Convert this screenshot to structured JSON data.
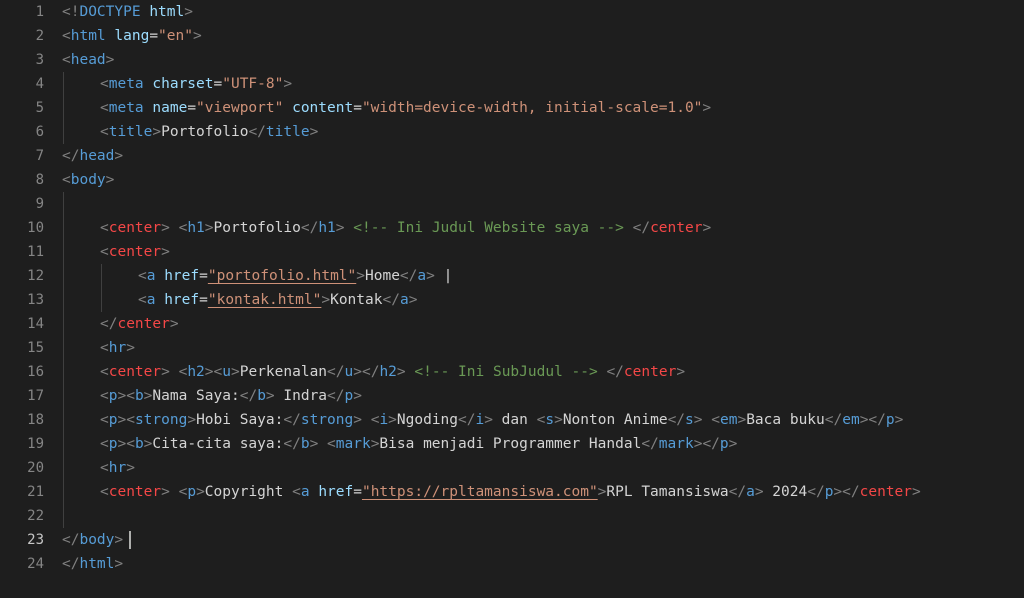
{
  "editor": {
    "language": "html",
    "current_line": 23,
    "lines": [
      {
        "n": "1",
        "indent": 0,
        "tokens": [
          [
            "p",
            "<!"
          ],
          [
            "t",
            "DOCTYPE"
          ],
          [
            "x",
            " "
          ],
          [
            "a",
            "html"
          ],
          [
            "p",
            ">"
          ]
        ]
      },
      {
        "n": "2",
        "indent": 0,
        "tokens": [
          [
            "p",
            "<"
          ],
          [
            "t",
            "html"
          ],
          [
            "x",
            " "
          ],
          [
            "a",
            "lang"
          ],
          [
            "x",
            "="
          ],
          [
            "s",
            "\"en\""
          ],
          [
            "p",
            ">"
          ]
        ]
      },
      {
        "n": "3",
        "indent": 0,
        "tokens": [
          [
            "p",
            "<"
          ],
          [
            "t",
            "head"
          ],
          [
            "p",
            ">"
          ]
        ]
      },
      {
        "n": "4",
        "indent": 1,
        "tokens": [
          [
            "p",
            "<"
          ],
          [
            "t",
            "meta"
          ],
          [
            "x",
            " "
          ],
          [
            "a",
            "charset"
          ],
          [
            "x",
            "="
          ],
          [
            "s",
            "\"UTF-8\""
          ],
          [
            "p",
            ">"
          ]
        ]
      },
      {
        "n": "5",
        "indent": 1,
        "tokens": [
          [
            "p",
            "<"
          ],
          [
            "t",
            "meta"
          ],
          [
            "x",
            " "
          ],
          [
            "a",
            "name"
          ],
          [
            "x",
            "="
          ],
          [
            "s",
            "\"viewport\""
          ],
          [
            "x",
            " "
          ],
          [
            "a",
            "content"
          ],
          [
            "x",
            "="
          ],
          [
            "s",
            "\"width=device-width, initial-scale=1.0\""
          ],
          [
            "p",
            ">"
          ]
        ]
      },
      {
        "n": "6",
        "indent": 1,
        "tokens": [
          [
            "p",
            "<"
          ],
          [
            "t",
            "title"
          ],
          [
            "p",
            ">"
          ],
          [
            "x",
            "Portofolio"
          ],
          [
            "p",
            "</"
          ],
          [
            "t",
            "title"
          ],
          [
            "p",
            ">"
          ]
        ]
      },
      {
        "n": "7",
        "indent": 0,
        "tokens": [
          [
            "p",
            "</"
          ],
          [
            "t",
            "head"
          ],
          [
            "p",
            ">"
          ]
        ]
      },
      {
        "n": "8",
        "indent": 0,
        "tokens": [
          [
            "p",
            "<"
          ],
          [
            "t",
            "body"
          ],
          [
            "p",
            ">"
          ]
        ]
      },
      {
        "n": "9",
        "indent": 0,
        "tokens": []
      },
      {
        "n": "10",
        "indent": 1,
        "tokens": [
          [
            "p",
            "<"
          ],
          [
            "r",
            "center"
          ],
          [
            "p",
            ">"
          ],
          [
            "x",
            " "
          ],
          [
            "p",
            "<"
          ],
          [
            "t",
            "h1"
          ],
          [
            "p",
            ">"
          ],
          [
            "x",
            "Portofolio"
          ],
          [
            "p",
            "</"
          ],
          [
            "t",
            "h1"
          ],
          [
            "p",
            ">"
          ],
          [
            "x",
            " "
          ],
          [
            "c",
            "<!-- Ini Judul Website saya -->"
          ],
          [
            "x",
            " "
          ],
          [
            "p",
            "</"
          ],
          [
            "r",
            "center"
          ],
          [
            "p",
            ">"
          ]
        ]
      },
      {
        "n": "11",
        "indent": 1,
        "tokens": [
          [
            "p",
            "<"
          ],
          [
            "r",
            "center"
          ],
          [
            "p",
            ">"
          ]
        ]
      },
      {
        "n": "12",
        "indent": 2,
        "tokens": [
          [
            "p",
            "<"
          ],
          [
            "t",
            "a"
          ],
          [
            "x",
            " "
          ],
          [
            "a",
            "href"
          ],
          [
            "x",
            "="
          ],
          [
            "su",
            "\"portofolio.html\""
          ],
          [
            "p",
            ">"
          ],
          [
            "x",
            "Home"
          ],
          [
            "p",
            "</"
          ],
          [
            "t",
            "a"
          ],
          [
            "p",
            ">"
          ],
          [
            "x",
            " | "
          ]
        ]
      },
      {
        "n": "13",
        "indent": 2,
        "tokens": [
          [
            "p",
            "<"
          ],
          [
            "t",
            "a"
          ],
          [
            "x",
            " "
          ],
          [
            "a",
            "href"
          ],
          [
            "x",
            "="
          ],
          [
            "su",
            "\"kontak.html\""
          ],
          [
            "p",
            ">"
          ],
          [
            "x",
            "Kontak"
          ],
          [
            "p",
            "</"
          ],
          [
            "t",
            "a"
          ],
          [
            "p",
            ">"
          ]
        ]
      },
      {
        "n": "14",
        "indent": 1,
        "tokens": [
          [
            "p",
            "</"
          ],
          [
            "r",
            "center"
          ],
          [
            "p",
            ">"
          ]
        ]
      },
      {
        "n": "15",
        "indent": 1,
        "tokens": [
          [
            "p",
            "<"
          ],
          [
            "t",
            "hr"
          ],
          [
            "p",
            ">"
          ]
        ]
      },
      {
        "n": "16",
        "indent": 1,
        "tokens": [
          [
            "p",
            "<"
          ],
          [
            "r",
            "center"
          ],
          [
            "p",
            ">"
          ],
          [
            "x",
            " "
          ],
          [
            "p",
            "<"
          ],
          [
            "t",
            "h2"
          ],
          [
            "p",
            "><"
          ],
          [
            "t",
            "u"
          ],
          [
            "p",
            ">"
          ],
          [
            "x",
            "Perkenalan"
          ],
          [
            "p",
            "</"
          ],
          [
            "t",
            "u"
          ],
          [
            "p",
            "></"
          ],
          [
            "t",
            "h2"
          ],
          [
            "p",
            ">"
          ],
          [
            "x",
            " "
          ],
          [
            "c",
            "<!-- Ini SubJudul -->"
          ],
          [
            "x",
            " "
          ],
          [
            "p",
            "</"
          ],
          [
            "r",
            "center"
          ],
          [
            "p",
            ">"
          ]
        ]
      },
      {
        "n": "17",
        "indent": 1,
        "tokens": [
          [
            "p",
            "<"
          ],
          [
            "t",
            "p"
          ],
          [
            "p",
            "><"
          ],
          [
            "t",
            "b"
          ],
          [
            "p",
            ">"
          ],
          [
            "x",
            "Nama Saya:"
          ],
          [
            "p",
            "</"
          ],
          [
            "t",
            "b"
          ],
          [
            "p",
            ">"
          ],
          [
            "x",
            " Indra"
          ],
          [
            "p",
            "</"
          ],
          [
            "t",
            "p"
          ],
          [
            "p",
            ">"
          ]
        ]
      },
      {
        "n": "18",
        "indent": 1,
        "tokens": [
          [
            "p",
            "<"
          ],
          [
            "t",
            "p"
          ],
          [
            "p",
            "><"
          ],
          [
            "t",
            "strong"
          ],
          [
            "p",
            ">"
          ],
          [
            "x",
            "Hobi Saya:"
          ],
          [
            "p",
            "</"
          ],
          [
            "t",
            "strong"
          ],
          [
            "p",
            ">"
          ],
          [
            "x",
            " "
          ],
          [
            "p",
            "<"
          ],
          [
            "t",
            "i"
          ],
          [
            "p",
            ">"
          ],
          [
            "x",
            "Ngoding"
          ],
          [
            "p",
            "</"
          ],
          [
            "t",
            "i"
          ],
          [
            "p",
            ">"
          ],
          [
            "x",
            " dan "
          ],
          [
            "p",
            "<"
          ],
          [
            "t",
            "s"
          ],
          [
            "p",
            ">"
          ],
          [
            "x",
            "Nonton Anime"
          ],
          [
            "p",
            "</"
          ],
          [
            "t",
            "s"
          ],
          [
            "p",
            ">"
          ],
          [
            "x",
            " "
          ],
          [
            "p",
            "<"
          ],
          [
            "t",
            "em"
          ],
          [
            "p",
            ">"
          ],
          [
            "x",
            "Baca buku"
          ],
          [
            "p",
            "</"
          ],
          [
            "t",
            "em"
          ],
          [
            "p",
            "></"
          ],
          [
            "t",
            "p"
          ],
          [
            "p",
            ">"
          ]
        ]
      },
      {
        "n": "19",
        "indent": 1,
        "tokens": [
          [
            "p",
            "<"
          ],
          [
            "t",
            "p"
          ],
          [
            "p",
            "><"
          ],
          [
            "t",
            "b"
          ],
          [
            "p",
            ">"
          ],
          [
            "x",
            "Cita-cita saya:"
          ],
          [
            "p",
            "</"
          ],
          [
            "t",
            "b"
          ],
          [
            "p",
            ">"
          ],
          [
            "x",
            " "
          ],
          [
            "p",
            "<"
          ],
          [
            "t",
            "mark"
          ],
          [
            "p",
            ">"
          ],
          [
            "x",
            "Bisa menjadi Programmer Handal"
          ],
          [
            "p",
            "</"
          ],
          [
            "t",
            "mark"
          ],
          [
            "p",
            "></"
          ],
          [
            "t",
            "p"
          ],
          [
            "p",
            ">"
          ]
        ]
      },
      {
        "n": "20",
        "indent": 1,
        "tokens": [
          [
            "p",
            "<"
          ],
          [
            "t",
            "hr"
          ],
          [
            "p",
            ">"
          ]
        ]
      },
      {
        "n": "21",
        "indent": 1,
        "tokens": [
          [
            "p",
            "<"
          ],
          [
            "r",
            "center"
          ],
          [
            "p",
            ">"
          ],
          [
            "x",
            " "
          ],
          [
            "p",
            "<"
          ],
          [
            "t",
            "p"
          ],
          [
            "p",
            ">"
          ],
          [
            "x",
            "Copyright "
          ],
          [
            "p",
            "<"
          ],
          [
            "t",
            "a"
          ],
          [
            "x",
            " "
          ],
          [
            "a",
            "href"
          ],
          [
            "x",
            "="
          ],
          [
            "su",
            "\"https://rpltamansiswa.com\""
          ],
          [
            "p",
            ">"
          ],
          [
            "x",
            "RPL Tamansiswa"
          ],
          [
            "p",
            "</"
          ],
          [
            "t",
            "a"
          ],
          [
            "p",
            ">"
          ],
          [
            "x",
            " 2024"
          ],
          [
            "p",
            "</"
          ],
          [
            "t",
            "p"
          ],
          [
            "p",
            "></"
          ],
          [
            "r",
            "center"
          ],
          [
            "p",
            ">"
          ]
        ]
      },
      {
        "n": "22",
        "indent": 0,
        "tokens": []
      },
      {
        "n": "23",
        "indent": 0,
        "tokens": [
          [
            "p",
            "</"
          ],
          [
            "t",
            "body"
          ],
          [
            "p",
            ">"
          ]
        ]
      },
      {
        "n": "24",
        "indent": 0,
        "tokens": [
          [
            "p",
            "</"
          ],
          [
            "t",
            "html"
          ],
          [
            "p",
            ">"
          ]
        ]
      }
    ]
  }
}
